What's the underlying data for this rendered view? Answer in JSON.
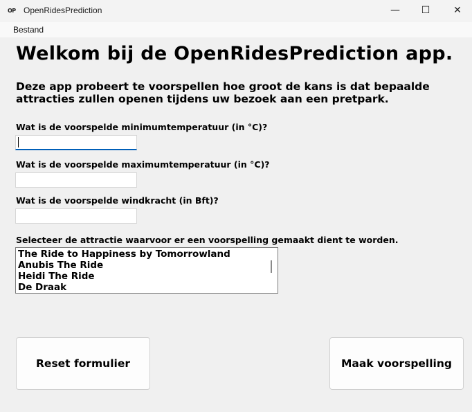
{
  "window": {
    "icon_text": "OP",
    "title": "OpenRidesPrediction",
    "minimize": "—",
    "maximize": "☐",
    "close": "✕"
  },
  "menu": {
    "items": [
      "Bestand"
    ]
  },
  "main": {
    "heading": "Welkom bij de OpenRidesPrediction app.",
    "intro": "Deze app probeert te voorspellen hoe groot de kans is dat bepaalde attracties zullen openen tijdens uw bezoek aan een pretpark.",
    "min_temp_label": "Wat is de voorspelde minimumtemperatuur (in °C)?",
    "min_temp_value": "",
    "max_temp_label": "Wat is de voorspelde maximumtemperatuur (in °C)?",
    "max_temp_value": "",
    "wind_label": "Wat is de voorspelde windkracht (in Bft)?",
    "wind_value": "",
    "attraction_label": "Selecteer de attractie waarvoor er een voorspelling gemaakt dient te worden.",
    "attractions": [
      "The Ride to Happiness by Tomorrowland",
      "Anubis The Ride",
      "Heidi The Ride",
      "De Draak"
    ]
  },
  "buttons": {
    "reset": "Reset formulier",
    "predict": "Maak voorspelling"
  }
}
